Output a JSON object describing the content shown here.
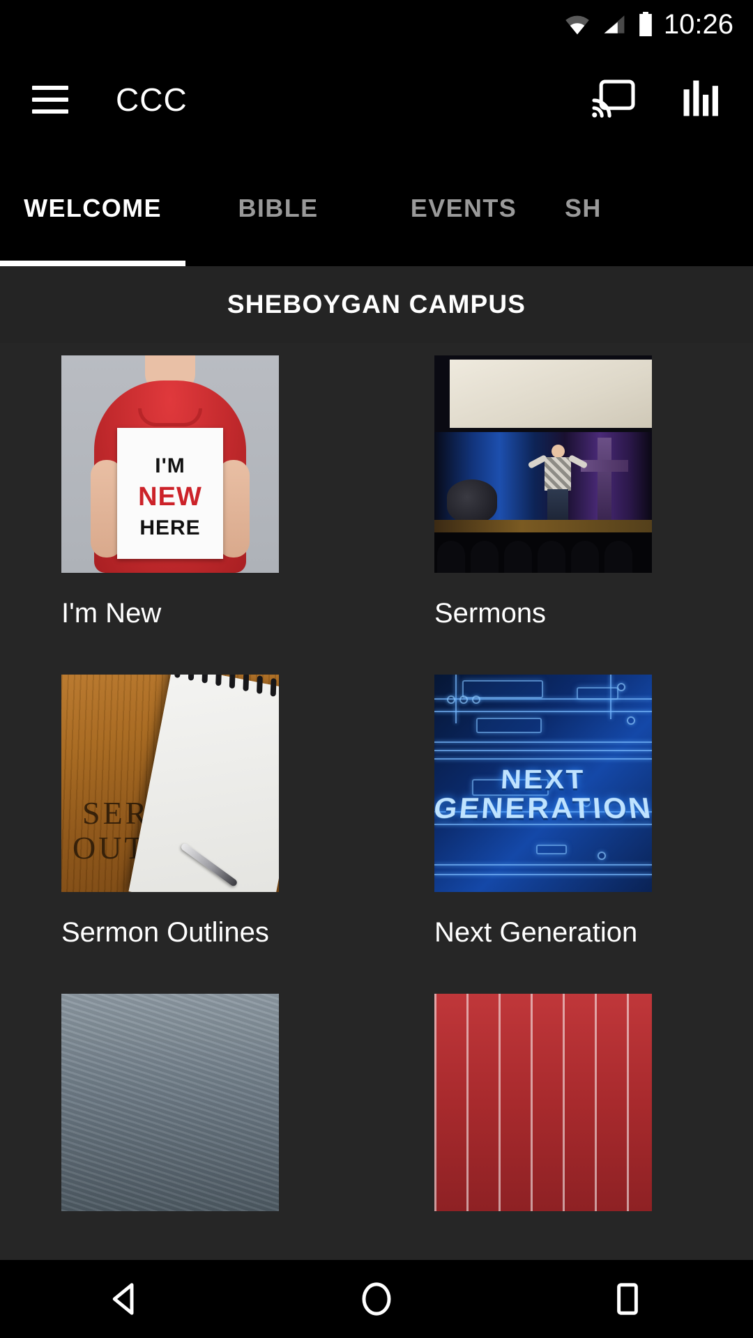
{
  "status_bar": {
    "time": "10:26",
    "icons": [
      "wifi-icon",
      "cellular-signal-icon",
      "battery-icon"
    ]
  },
  "app_bar": {
    "title": "CCC",
    "menu_icon": "hamburger-menu-icon",
    "cast_icon": "cast-icon",
    "stats_icon": "bar-chart-icon"
  },
  "tabs": [
    {
      "label": "WELCOME",
      "active": true
    },
    {
      "label": "BIBLE",
      "active": false
    },
    {
      "label": "EVENTS",
      "active": false
    },
    {
      "label": "SH",
      "active": false
    }
  ],
  "campus_header": {
    "label": "SHEBOYGAN CAMPUS"
  },
  "grid": {
    "items": [
      {
        "label": "I'm New",
        "art": "im-new-here-sign",
        "sign_line1": "I'M",
        "sign_line2": "NEW",
        "sign_line3": "HERE"
      },
      {
        "label": "Sermons",
        "art": "stage-speaker-photo"
      },
      {
        "label": "Sermon Outlines",
        "art": "notepad-on-wood",
        "wood_word1": "SERMON",
        "wood_word2": "OUTLINES"
      },
      {
        "label": "Next Generation",
        "art": "circuit-board-graphic",
        "graphic_line1": "NEXT",
        "graphic_line2": "GENERATION"
      }
    ]
  },
  "nav_bar": {
    "back_icon": "back-triangle-icon",
    "home_icon": "home-circle-icon",
    "recents_icon": "recents-square-icon"
  },
  "colors": {
    "background": "#262626",
    "bar_background": "#000000",
    "campus_bar": "#242424",
    "accent_text": "#ffffff",
    "inactive_tab": "#9a9a9a",
    "red": "#cc2229",
    "blue": "#1448a8"
  }
}
